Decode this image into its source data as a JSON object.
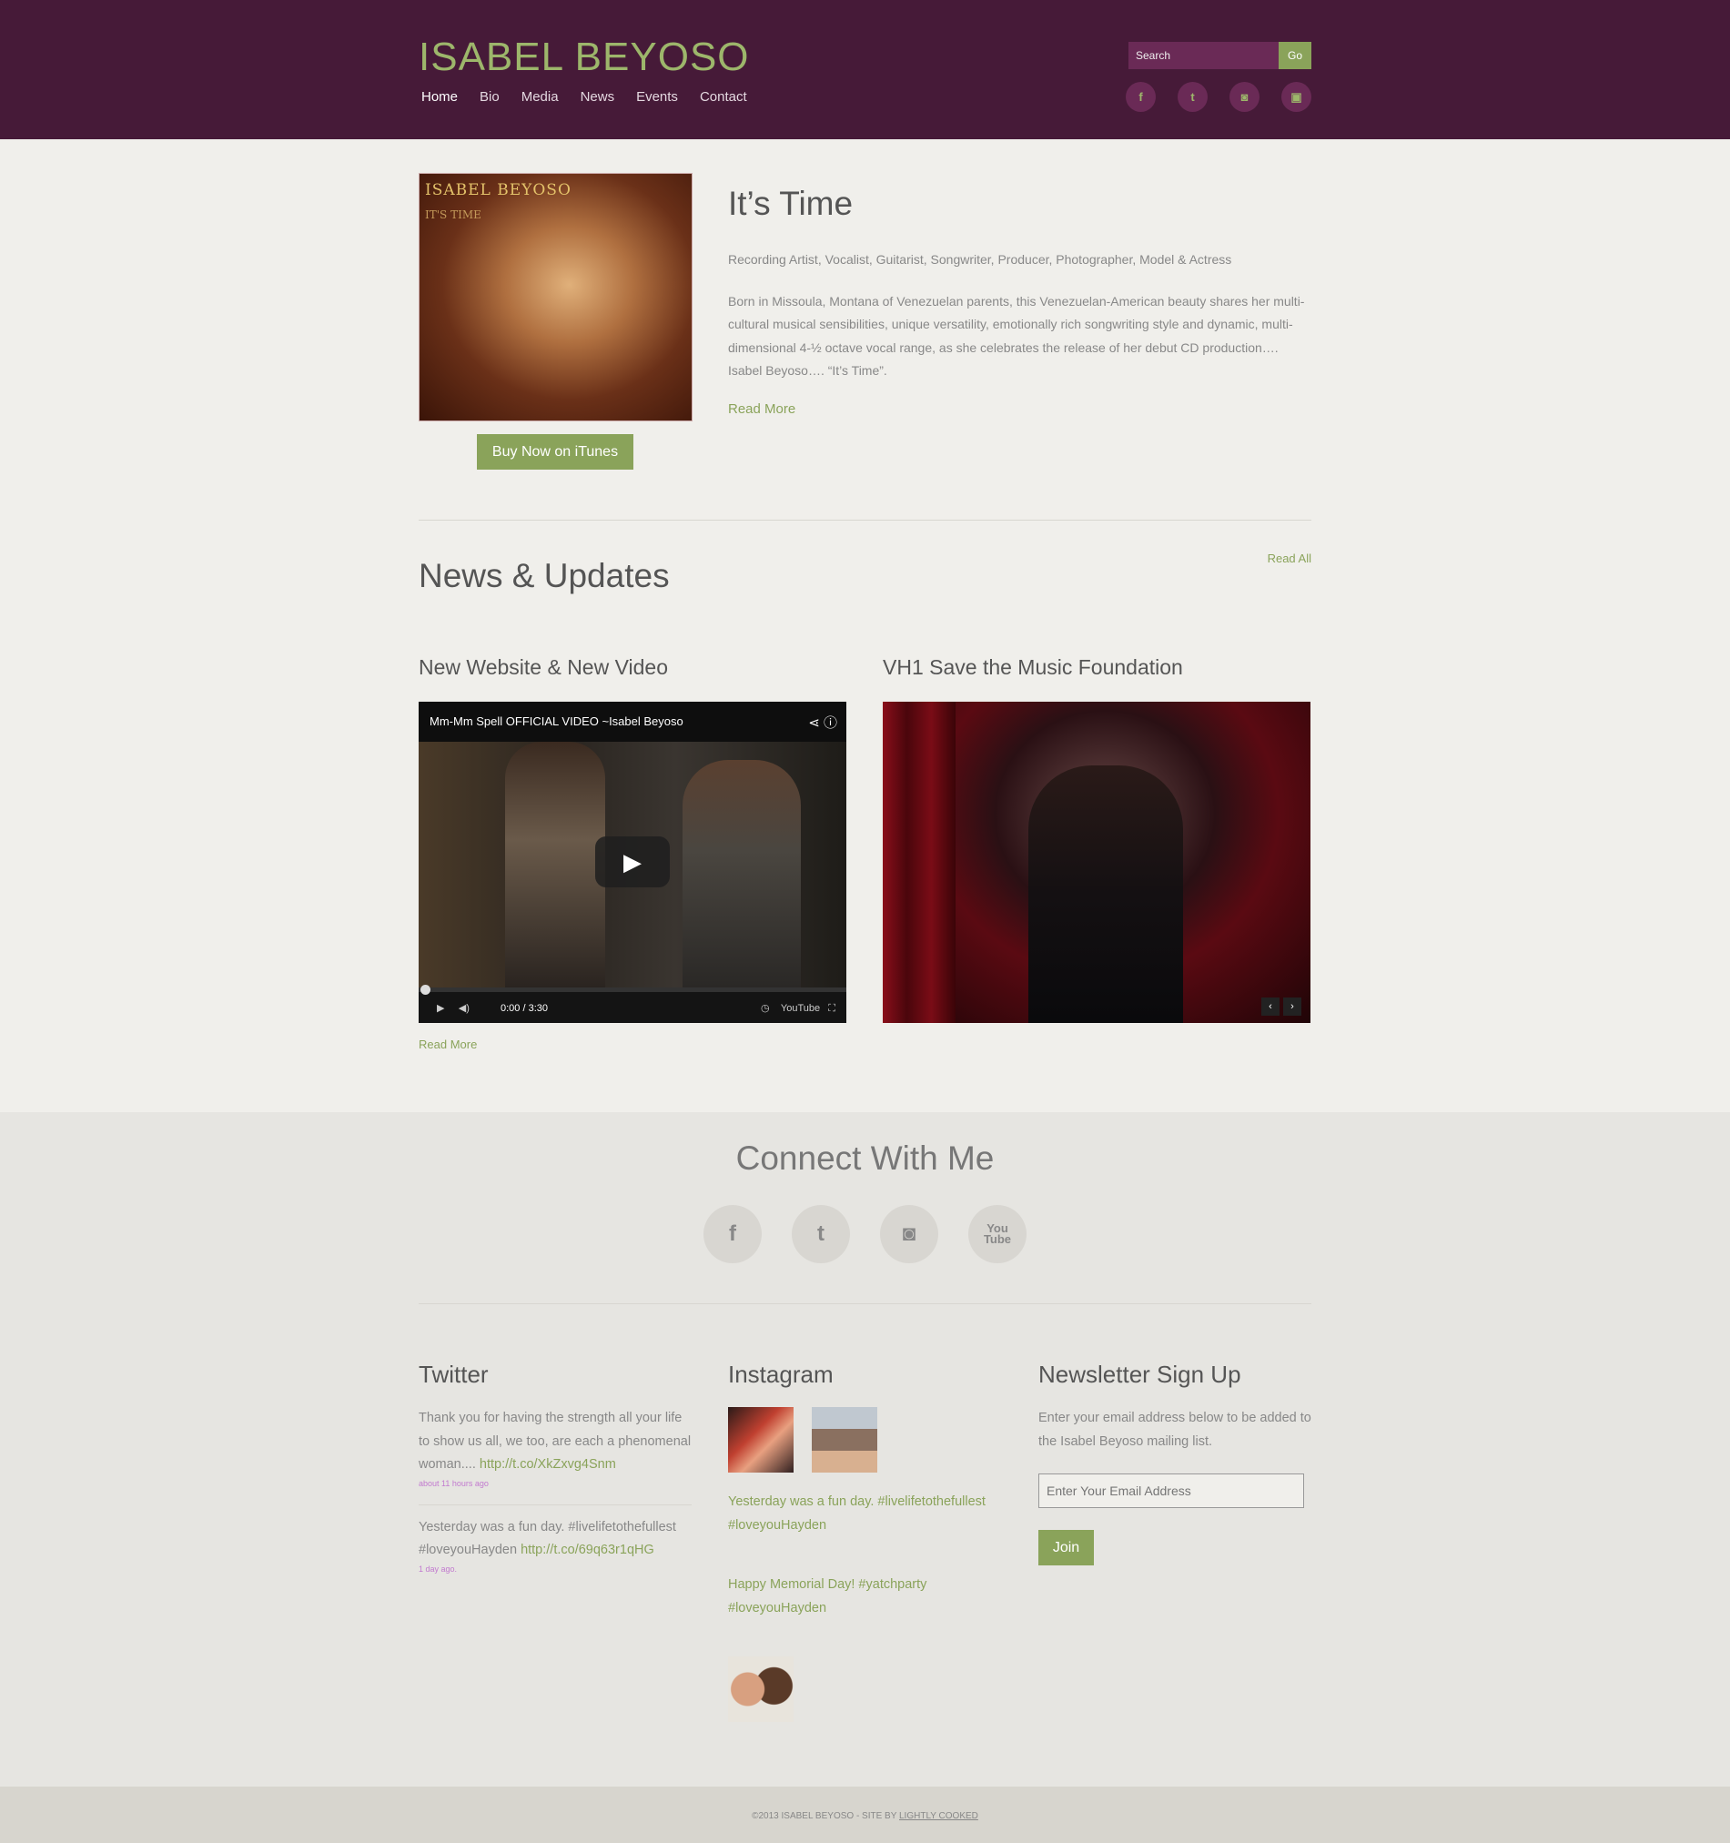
{
  "header": {
    "logo": "ISABEL BEYOSO",
    "nav": [
      "Home",
      "Bio",
      "Media",
      "News",
      "Events",
      "Contact"
    ],
    "search_placeholder": "Search",
    "search_button": "Go",
    "social_icons": [
      "facebook-icon",
      "twitter-icon",
      "instagram-icon",
      "youtube-icon"
    ]
  },
  "hero": {
    "album_title": "ISABEL BEYOSO",
    "album_subtitle": "IT'S TIME",
    "buy_button": "Buy Now on iTunes",
    "title": "It’s Time",
    "tagline": "Recording Artist, Vocalist, Guitarist, Songwriter, Producer, Photographer, Model & Actress",
    "body": "Born in Missoula, Montana of Venezuelan parents, this Venezuelan-American beauty shares her multi-cultural musical sensibilities, unique versatility, emotionally rich songwriting style and dynamic, multi-dimensional 4-½ octave vocal range, as she celebrates the release of her debut CD production…. Isabel Beyoso…. “It’s Time”.",
    "read_more": "Read More"
  },
  "news": {
    "title": "News & Updates",
    "read_all": "Read All",
    "posts": [
      {
        "title": "New Website & New Video",
        "video_title": "Mm-Mm Spell OFFICIAL VIDEO ~Isabel Beyoso",
        "video_time": "0:00 / 3:30",
        "youtube_label": "YouTube",
        "read_more": "Read More"
      },
      {
        "title": "VH1 Save the Music Foundation"
      }
    ]
  },
  "connect": {
    "title": "Connect With Me",
    "icons": [
      "facebook-icon",
      "twitter-icon",
      "instagram-icon",
      "youtube-icon"
    ]
  },
  "twitter": {
    "title": "Twitter",
    "tweets": [
      {
        "text": "Thank you for having the strength all your life to show us all, we too, are each a phenomenal woman.... ",
        "link": "http://t.co/XkZxvg4Snm",
        "ago": "about 11 hours ago"
      },
      {
        "text": "Yesterday was a fun day. #livelifetothefullest #loveyouHayden ",
        "link": "http://t.co/69q63r1qHG",
        "ago": "1 day ago."
      }
    ]
  },
  "instagram": {
    "title": "Instagram",
    "captions": [
      "Yesterday was a fun day. #livelifetothefullest #loveyouHayden",
      "Happy Memorial Day! #yatchparty #loveyouHayden"
    ]
  },
  "newsletter": {
    "title": "Newsletter Sign Up",
    "text": "Enter your email address below to be added to the Isabel Beyoso mailing list.",
    "placeholder": "Enter Your Email Address",
    "button": "Join"
  },
  "footer": {
    "copyright": "©2013 ISABEL BEYOSO - SITE BY ",
    "credit": "LIGHTLY COOKED"
  }
}
